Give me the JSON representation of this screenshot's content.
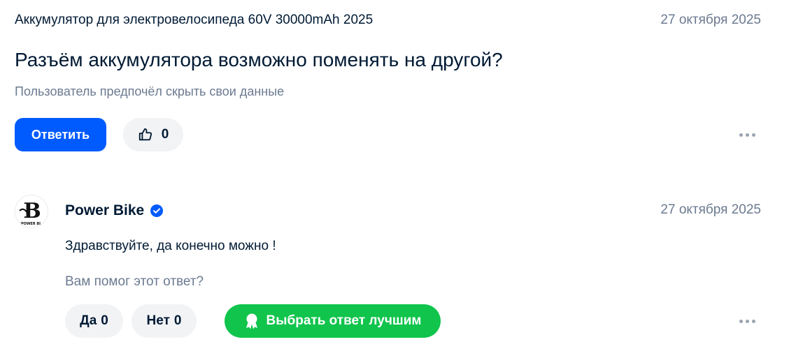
{
  "question": {
    "product_title": "Аккумулятор для электровелосипеда 60V 30000mAh 2025",
    "date": "27 октября 2025",
    "text": "Разъём аккумулятора возможно поменять на другой?",
    "author": "Пользователь предпочёл скрыть свои данные",
    "reply_label": "Ответить",
    "like_count": "0",
    "icons": {
      "like": "thumbs-up-icon",
      "more": "more-dots-icon"
    }
  },
  "answer": {
    "seller_name": "Power Bike",
    "date": "27 октября 2025",
    "text": "Здравствуйте, да конечно можно !",
    "helpful_question": "Вам помог этот ответ?",
    "yes_label": "Да",
    "yes_count": "0",
    "no_label": "Нет",
    "no_count": "0",
    "best_label": "Выбрать ответ лучшим",
    "avatar_text": "B",
    "avatar_caption": "POWER BI",
    "icons": {
      "verified": "verified-check-icon",
      "best": "award-icon",
      "more": "more-dots-icon"
    }
  },
  "colors": {
    "primary_blue": "#005bff",
    "success_green": "#10c44c",
    "text_primary": "#001a34",
    "text_secondary": "#6b7a90",
    "chip_bg": "#f2f3f5"
  }
}
